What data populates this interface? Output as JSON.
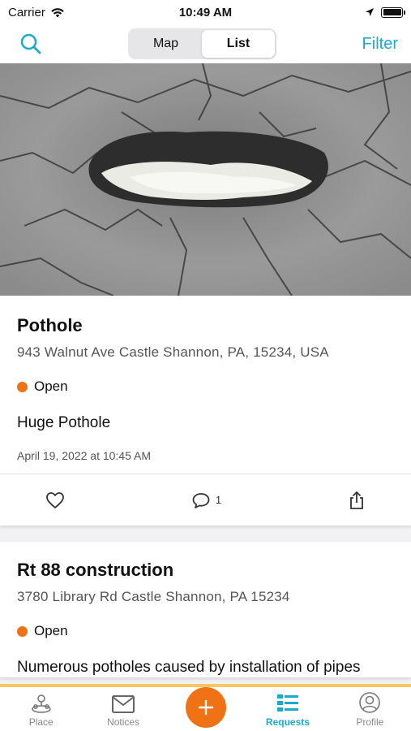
{
  "status_bar": {
    "carrier": "Carrier",
    "time": "10:49 AM"
  },
  "nav": {
    "segments": [
      {
        "label": "Map",
        "active": false
      },
      {
        "label": "List",
        "active": true
      }
    ],
    "filter_label": "Filter",
    "icon": "search-icon"
  },
  "requests": [
    {
      "title": "Pothole",
      "address": "943 Walnut Ave Castle Shannon, PA, 15234, USA",
      "status": "Open",
      "status_color": "#ef7214",
      "description": "Huge Pothole",
      "date": "April 19, 2022 at 10:45 AM",
      "comment_count": "1"
    },
    {
      "title": "Rt 88 construction",
      "address": "3780 Library Rd Castle Shannon, PA 15234",
      "status": "Open",
      "status_color": "#ef7214",
      "description": "Numerous potholes caused by installation of pipes"
    }
  ],
  "tabs": [
    {
      "label": "Place",
      "icon": "place-icon"
    },
    {
      "label": "Notices",
      "icon": "mail-icon"
    },
    {
      "label": "",
      "icon": "plus-icon"
    },
    {
      "label": "Requests",
      "icon": "list-icon",
      "active": true
    },
    {
      "label": "Profile",
      "icon": "profile-icon"
    }
  ],
  "colors": {
    "accent": "#1ea9c9",
    "primary_action": "#ef7214",
    "tab_top_border": "#f7c65f"
  }
}
